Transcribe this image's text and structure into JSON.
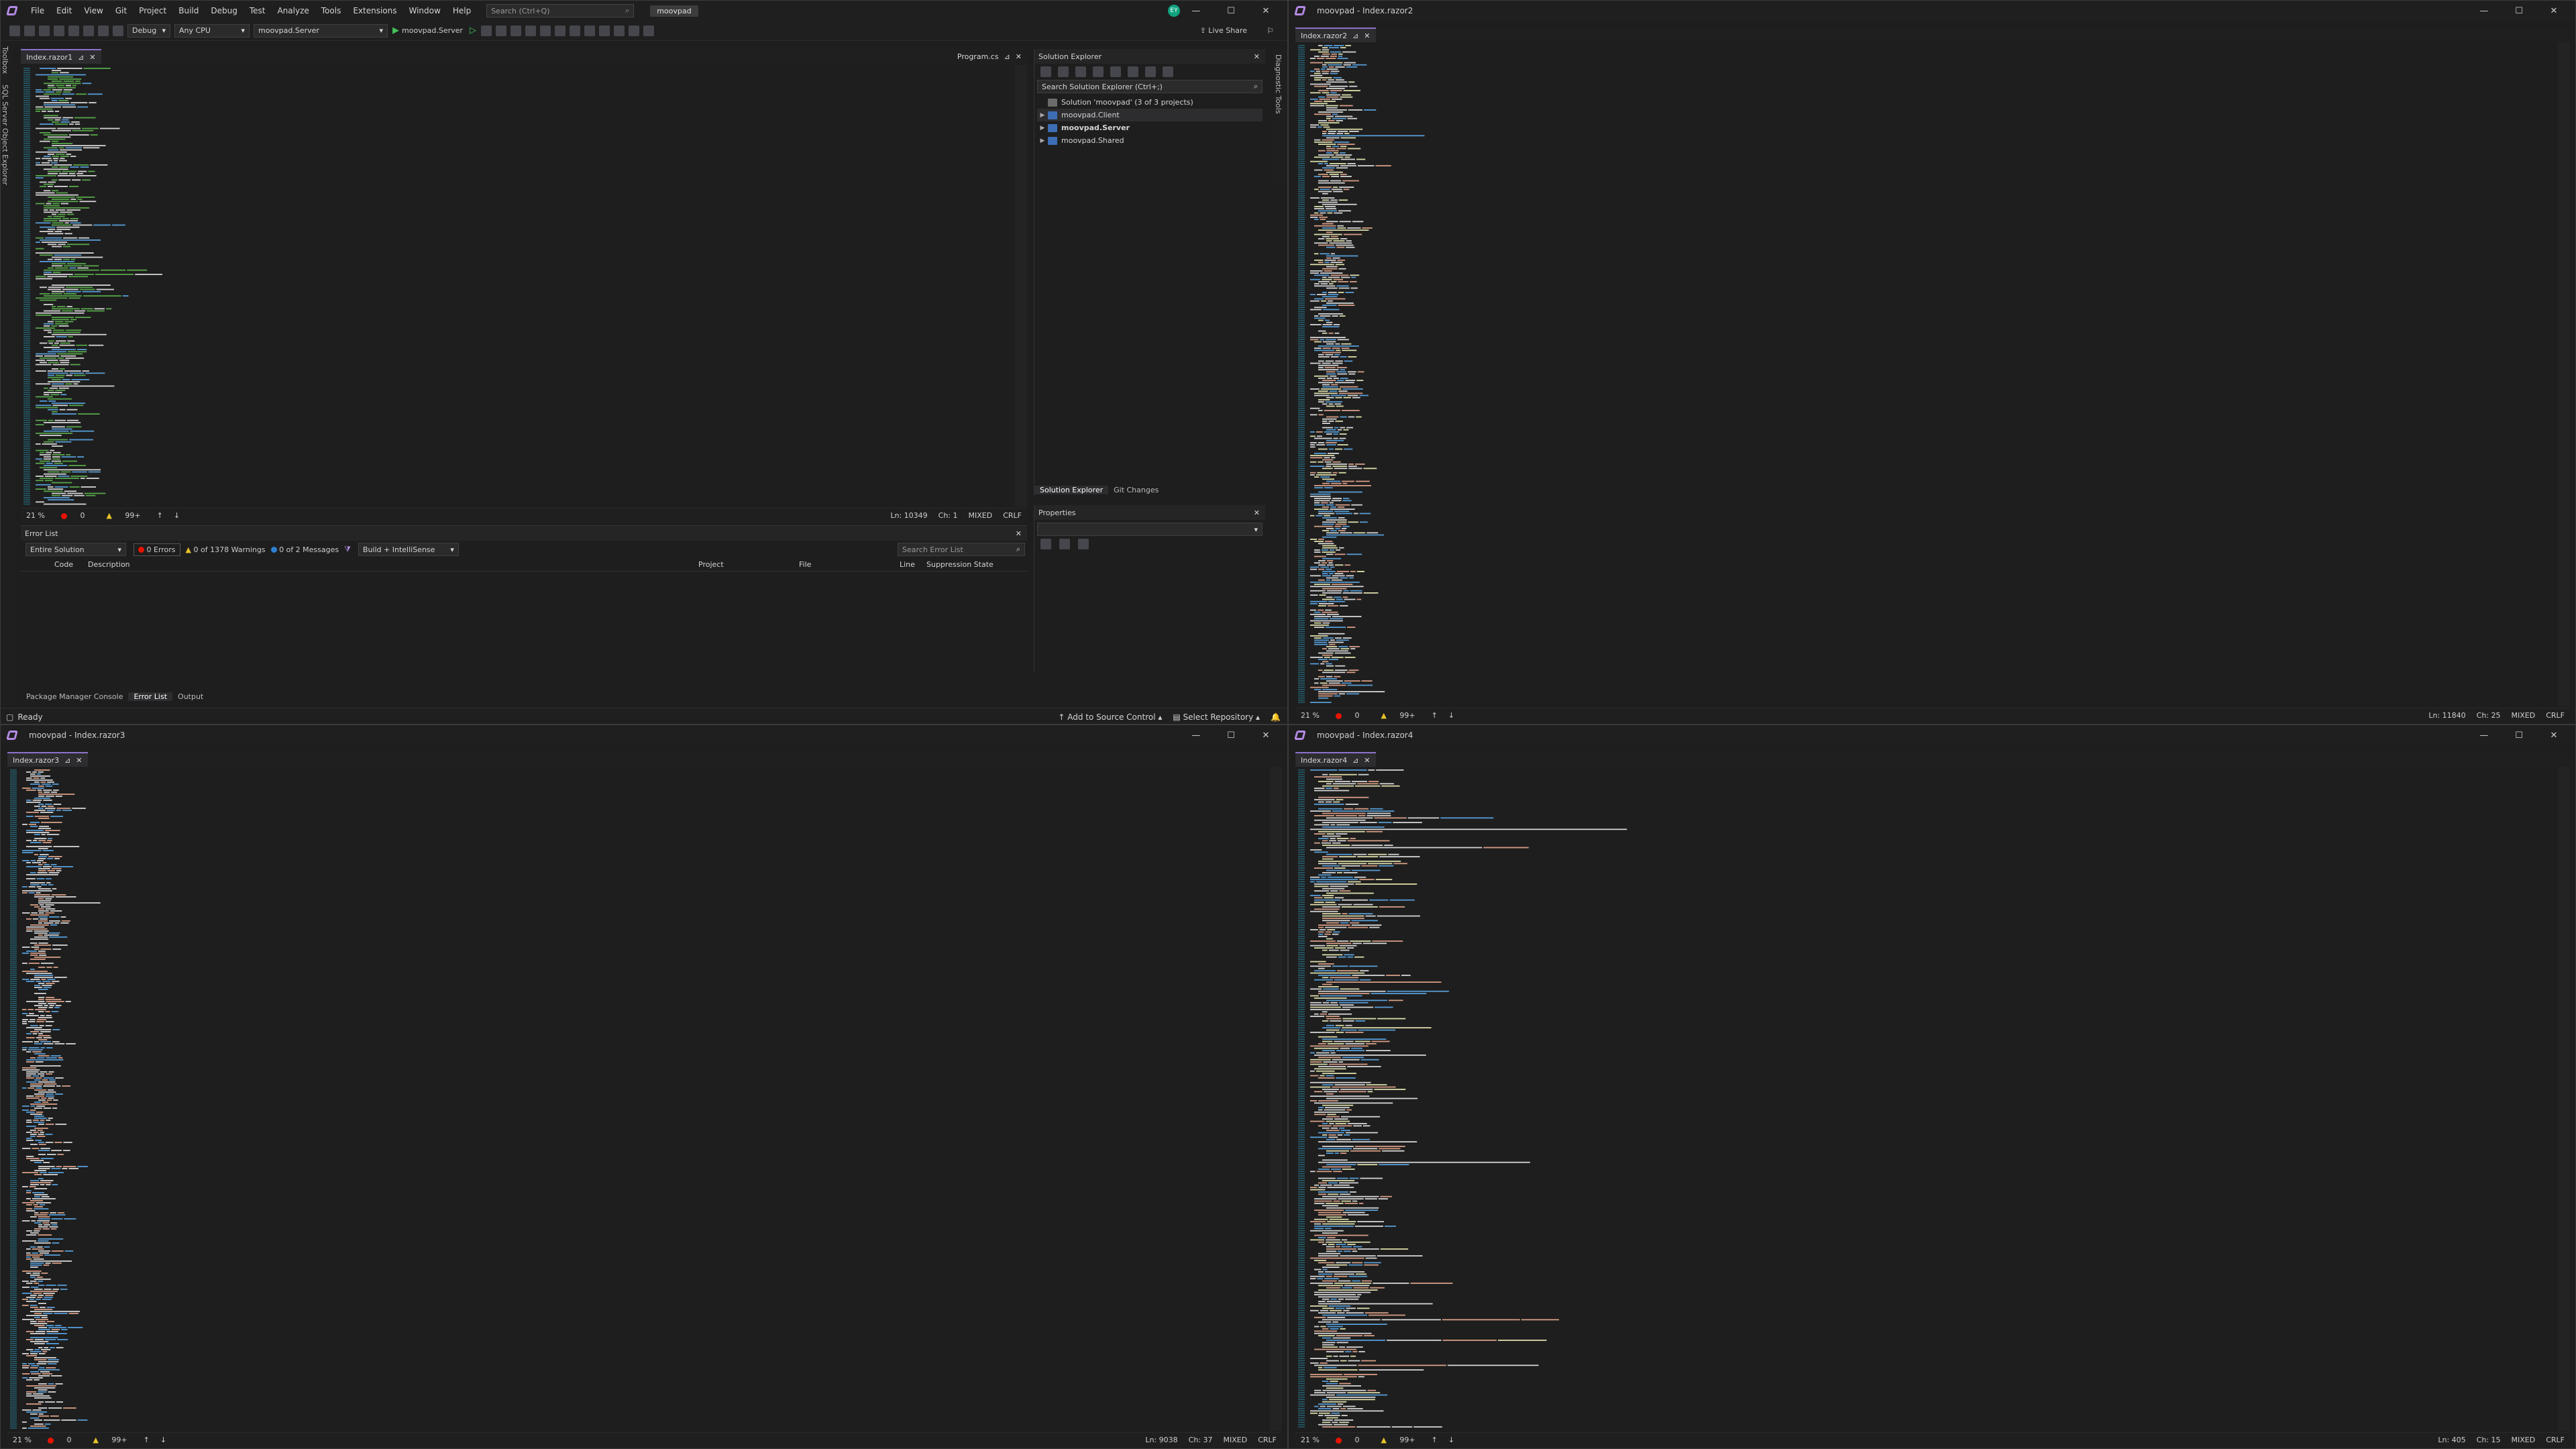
{
  "main_window": {
    "menu": [
      "File",
      "Edit",
      "View",
      "Git",
      "Project",
      "Build",
      "Debug",
      "Test",
      "Analyze",
      "Tools",
      "Extensions",
      "Window",
      "Help"
    ],
    "search_placeholder": "Search (Ctrl+Q)",
    "solution_name": "moovpad",
    "avatar_initials": "EY",
    "live_share": "Live Share",
    "toolbar": {
      "config": "Debug",
      "platform": "Any CPU",
      "startup": "moovpad.Server",
      "run_target": "moovpad.Server"
    },
    "side_tabs": [
      "Toolbox",
      "SQL Server Object Explorer"
    ],
    "right_side_tabs": [
      "Diagnostic Tools"
    ],
    "editor": {
      "tab": "Index.razor1",
      "second_tab": "Program.cs",
      "zoom": "21 %",
      "errors": "0",
      "warnings": "99+",
      "position": "Ln: 10349",
      "column": "Ch: 1",
      "encoding": "MIXED",
      "line_ending": "CRLF"
    },
    "error_list": {
      "title": "Error List",
      "scope": "Entire Solution",
      "errors_btn": "0 Errors",
      "warnings_btn": "0 of 1378 Warnings",
      "messages_btn": "0 of 2 Messages",
      "build_filter": "Build + IntelliSense",
      "search_placeholder": "Search Error List",
      "columns": [
        "Code",
        "Description",
        "Project",
        "File",
        "Line",
        "Suppression State"
      ]
    },
    "bottom_tabs": [
      "Package Manager Console",
      "Error List",
      "Output"
    ],
    "solution_explorer": {
      "title": "Solution Explorer",
      "search_placeholder": "Search Solution Explorer (Ctrl+;)",
      "solution": "Solution 'moovpad' (3 of 3 projects)",
      "projects": [
        "moovpad.Client",
        "moovpad.Server",
        "moovpad.Shared"
      ],
      "tabs": [
        "Solution Explorer",
        "Git Changes"
      ]
    },
    "properties": {
      "title": "Properties"
    },
    "status": {
      "ready": "Ready",
      "source_control": "Add to Source Control",
      "repository": "Select Repository"
    }
  },
  "window2": {
    "title": "moovpad - Index.razor2",
    "tab": "Index.razor2",
    "zoom": "21 %",
    "errors": "0",
    "warnings": "99+",
    "position": "Ln: 11840",
    "column": "Ch: 25",
    "encoding": "MIXED",
    "line_ending": "CRLF"
  },
  "window3": {
    "title": "moovpad - Index.razor3",
    "tab": "Index.razor3",
    "zoom": "21 %",
    "errors": "0",
    "warnings": "99+",
    "position": "Ln: 9038",
    "column": "Ch: 37",
    "encoding": "MIXED",
    "line_ending": "CRLF"
  },
  "window4": {
    "title": "moovpad - Index.razor4",
    "tab": "Index.razor4",
    "zoom": "21 %",
    "errors": "0",
    "warnings": "99+",
    "position": "Ln: 405",
    "column": "Ch: 15",
    "encoding": "MIXED",
    "line_ending": "CRLF"
  },
  "colors": {
    "background": "#1e1e1e",
    "chrome": "#1f1f1f",
    "accent": "#8e72c9",
    "code_green": "#57a64a",
    "code_white": "#d4d4d4",
    "code_blue": "#569cd6",
    "code_yellow": "#dcdcaa",
    "code_orange": "#d69d85",
    "change_mark": "#4ba34b"
  }
}
